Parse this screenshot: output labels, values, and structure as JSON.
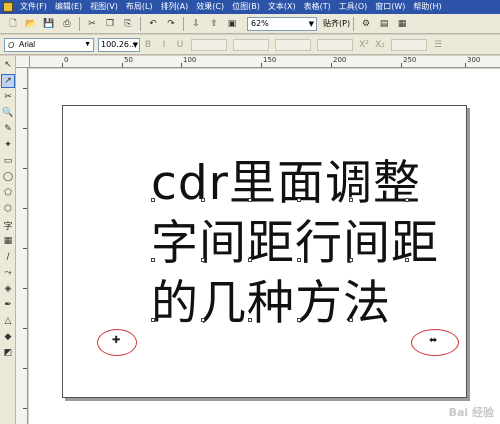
{
  "menu": {
    "items": [
      "文件(F)",
      "编辑(E)",
      "视图(V)",
      "布局(L)",
      "排列(A)",
      "效果(C)",
      "位图(B)",
      "文本(X)",
      "表格(T)",
      "工具(O)",
      "窗口(W)",
      "帮助(H)"
    ]
  },
  "toolbar": {
    "zoom_value": "62%",
    "snap_label": "贴齐(P)"
  },
  "property_bar": {
    "font_name": "Arial",
    "font_size": "100.26..."
  },
  "ruler": {
    "h_labels": [
      "0",
      "50",
      "100",
      "150",
      "200",
      "250",
      "300"
    ]
  },
  "document": {
    "line1": "cdr里面调整",
    "line2": "字间距行间距",
    "line3": "的几种方法"
  },
  "watermark": {
    "text": "Bai 经验"
  },
  "colors": {
    "menubar": "#2b53a8",
    "annotation_red": "#d23a3a"
  },
  "icons": [
    "new-icon",
    "open-icon",
    "save-icon",
    "print-icon",
    "cut-icon",
    "copy-icon",
    "paste-icon",
    "undo-icon",
    "redo-icon",
    "import-icon",
    "export-icon",
    "pick-tool-icon",
    "shape-tool-icon",
    "zoom-tool-icon",
    "text-tool-icon"
  ]
}
